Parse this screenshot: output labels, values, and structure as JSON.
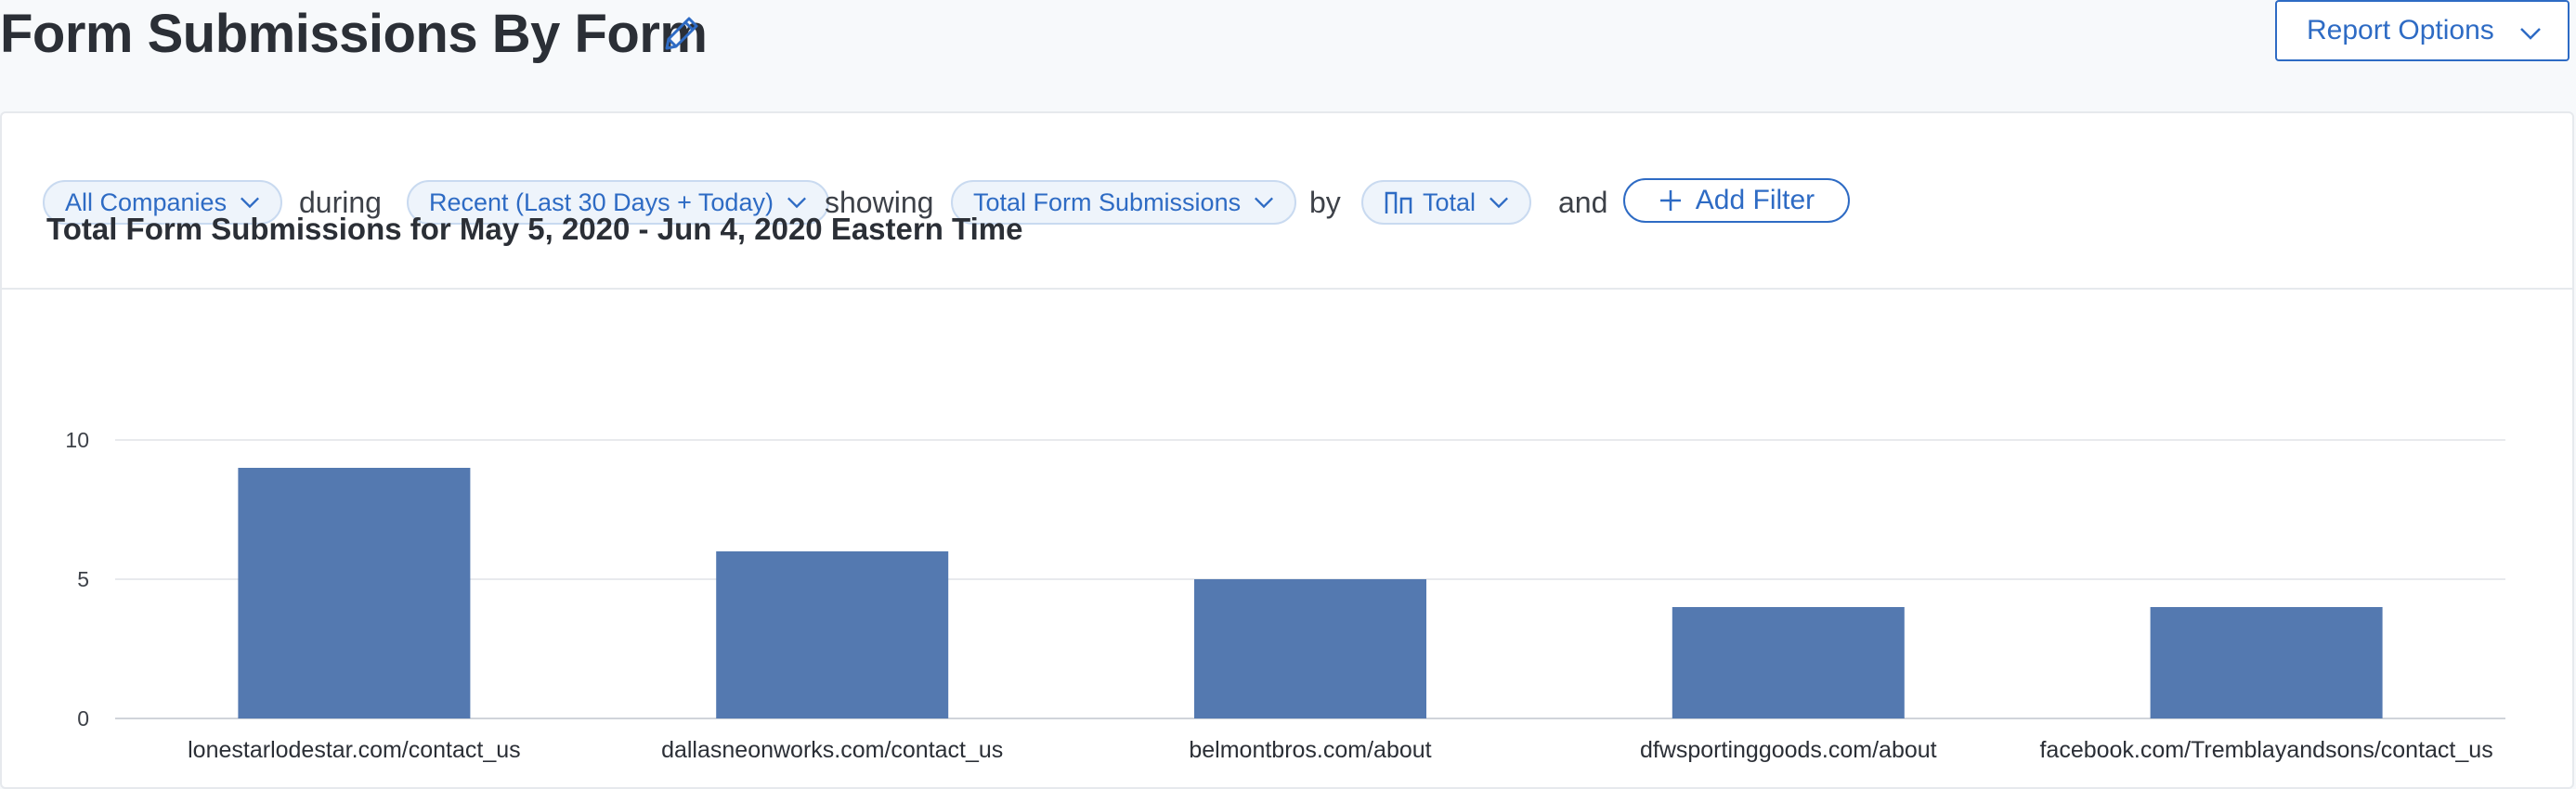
{
  "header": {
    "title": "Form Submissions By Form",
    "report_options_label": "Report Options"
  },
  "filters": {
    "company": "All Companies",
    "during_word": "during",
    "period": "Recent (Last 30 Days + Today)",
    "showing_word": "showing",
    "metric": "Total Form Submissions",
    "by_word": "by",
    "grouping": "Total",
    "and_word": "and",
    "add_filter_label": "Add Filter"
  },
  "colors": {
    "accent": "#2e6bc4",
    "bar": "#5479b0"
  },
  "chart_data": {
    "type": "bar",
    "title": "Total Form Submissions for May 5, 2020 - Jun 4, 2020 Eastern Time",
    "categories": [
      "lonestarlodestar.com/contact_us",
      "dallasneonworks.com/contact_us",
      "belmontbros.com/about",
      "dfwsportinggoods.com/about",
      "facebook.com/Tremblayandsons/contact_us"
    ],
    "values": [
      9,
      6,
      5,
      4,
      4
    ],
    "yticks": [
      0,
      5,
      10
    ],
    "ylim": [
      0,
      10
    ],
    "xlabel": "",
    "ylabel": "",
    "grid": true,
    "legend": "none"
  }
}
